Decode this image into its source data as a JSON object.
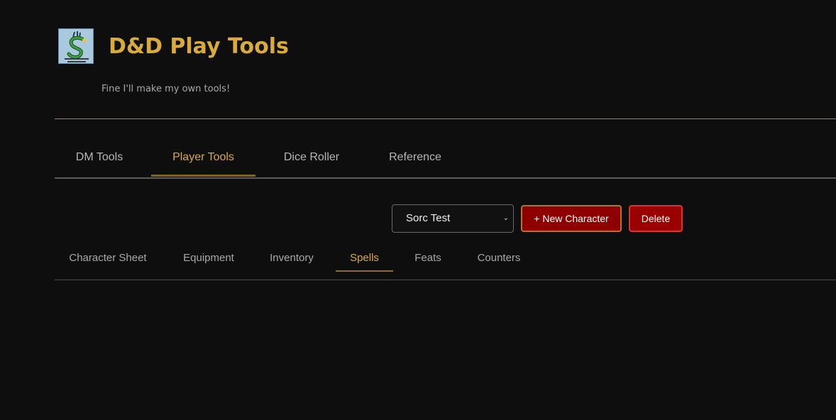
{
  "header": {
    "title": "D&D Play Tools",
    "tagline": "Fine I'll make my own tools!",
    "logo_icon": "tarrasque-sticker-logo"
  },
  "main_nav": {
    "tabs": [
      {
        "label": "DM Tools",
        "active": false
      },
      {
        "label": "Player Tools",
        "active": true
      },
      {
        "label": "Dice Roller",
        "active": false
      },
      {
        "label": "Reference",
        "active": false
      }
    ]
  },
  "character": {
    "selected": "Sorc Test",
    "new_button": "+ New Character",
    "delete_button": "Delete"
  },
  "sub_nav": {
    "tabs": [
      {
        "label": "Character Sheet",
        "active": false
      },
      {
        "label": "Equipment",
        "active": false
      },
      {
        "label": "Inventory",
        "active": false
      },
      {
        "label": "Spells",
        "active": true
      },
      {
        "label": "Feats",
        "active": false
      },
      {
        "label": "Counters",
        "active": false
      }
    ]
  },
  "colors": {
    "background": "#0e0e0e",
    "accent_gold": "#d8ab3c",
    "button_red": "#8e0000",
    "divider_orange": "#b57a3c"
  }
}
